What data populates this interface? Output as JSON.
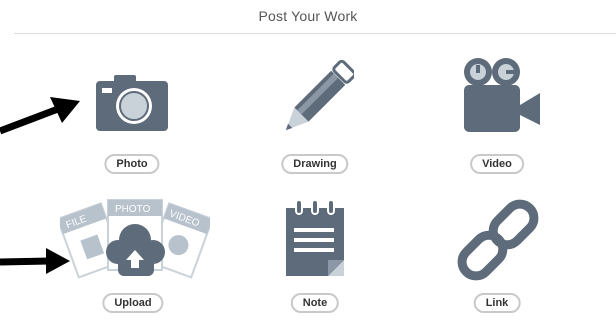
{
  "header": {
    "title": "Post Your Work"
  },
  "options": [
    {
      "id": "photo",
      "label": "Photo",
      "icon": "camera-icon"
    },
    {
      "id": "drawing",
      "label": "Drawing",
      "icon": "pencil-icon"
    },
    {
      "id": "video",
      "label": "Video",
      "icon": "video-camera-icon"
    },
    {
      "id": "upload",
      "label": "Upload",
      "icon": "cloud-upload-icon",
      "card_labels": [
        "FILE",
        "PHOTO",
        "VIDEO"
      ]
    },
    {
      "id": "note",
      "label": "Note",
      "icon": "notepad-icon"
    },
    {
      "id": "link",
      "label": "Link",
      "icon": "chain-link-icon"
    }
  ],
  "colors": {
    "icon": "#5d6b7b",
    "icon_light": "#c9d1d9",
    "card": "#b7c2cc",
    "arrow": "#000000"
  }
}
